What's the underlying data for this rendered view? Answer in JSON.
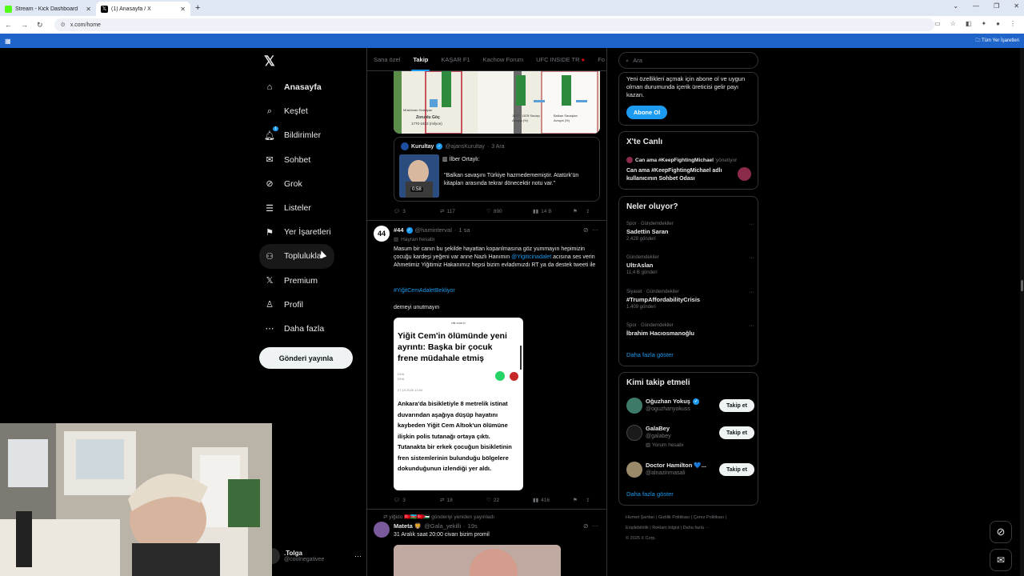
{
  "browser": {
    "tabs": [
      {
        "title": "Stream - Kick Dashboard",
        "fav_color": "#53fc18"
      },
      {
        "title": "(1) Anasayfa / X",
        "fav_color": "#000000"
      }
    ],
    "url": "x.com/home",
    "all_bookmarks": "Tüm Yer İşaretleri"
  },
  "sidebar": {
    "items": [
      {
        "label": "Anasayfa",
        "icon": "home-icon"
      },
      {
        "label": "Keşfet",
        "icon": "search-icon"
      },
      {
        "label": "Bildirimler",
        "icon": "bell-icon",
        "badge": "1"
      },
      {
        "label": "Sohbet",
        "icon": "mail-icon"
      },
      {
        "label": "Grok",
        "icon": "grok-icon"
      },
      {
        "label": "Listeler",
        "icon": "list-icon"
      },
      {
        "label": "Yer İşaretleri",
        "icon": "bookmark-icon"
      },
      {
        "label": "Topluluklar",
        "icon": "communities-icon"
      },
      {
        "label": "Premium",
        "icon": "x-icon"
      },
      {
        "label": "Profil",
        "icon": "profile-icon"
      },
      {
        "label": "Daha fazla",
        "icon": "more-icon"
      }
    ],
    "post_button": "Gönderi yayınla",
    "account": {
      "name": ".Tolga",
      "handle": "@coolnegativee"
    }
  },
  "feed": {
    "tabs": [
      "Sana özel",
      "Takip",
      "KAŞAR F1",
      "Kachow Forum",
      "UFC INSIDE TR",
      "Fo"
    ],
    "active_tab": "Takip",
    "chart_labels": [
      "Müslüman Hıristiyan",
      "Zorunlu Göç",
      "1770-1923 (milyon)",
      "1877 - 1878 Savaşı Avrupa (%)",
      "Balkan Savaşları Avrupa (%)"
    ],
    "quote": {
      "name": "Kurultay",
      "handle": "@ajansKurultay",
      "time": "3 Ara",
      "speaker": "İlber Ortaylı:",
      "video_time": "0:58",
      "text": "\"Balkan savaşını Türkiye hazmedememiştir. Atatürk'ün kitapları arasında tekrar dönecektir notu var.\""
    },
    "post1_actions": {
      "replies": "3",
      "reposts": "117",
      "likes": "890",
      "views": "14 B"
    },
    "post2": {
      "name": "#44",
      "handle": "@haminterval",
      "time": "1 sa",
      "subtitle": "Hayran hesabı",
      "text_a": "Masum bir canın bu şekilde hayattan koparılmasına göz yummayın hepimizin çocuğu kardeşi yeğeni var anne Nazlı Hanımın ",
      "mention": "@Yigiticinadalet",
      "text_b": " acısına ses verin Ahmetimiz Yiğitimiz Hakanımız hepsi bizim evladımızdı RT ya da destek tweeti ile",
      "hashtag": "#YiğitCemAdaletBekliyor",
      "text_c": "demeyi unutmayın",
      "card": {
        "source": "nfk.com.tr",
        "headline": "Yiğit Cem'in ölümünde yeni ayrıntı: Başka bir çocuk frene müdahale etmiş",
        "agency": "DHA",
        "agency2": "DHA",
        "date": "27.10.2025 13:04",
        "body": "Ankara'da bisikletiyle 8 metrelik istinat duvarından aşağıya düşüp hayatını kaybeden Yiğit Cem Altıok'un ölümüne ilişkin polis tutanağı ortaya çıktı. Tutanakta bir erkek çocuğun bisikletinin fren sistemlerinin bulunduğu bölgelere dokunduğunun izlendiği yer aldı."
      },
      "actions": {
        "replies": "3",
        "reposts": "18",
        "likes": "22",
        "views": "416"
      }
    },
    "post3": {
      "repost_by": "yiğido 🇹🇷🇦🇿🇹🇷🇵🇸 gönderiyi yeniden yayınladı",
      "name": "Mateta 🦁",
      "handle": "@Gala_yekilli",
      "time": "19s",
      "text": "31 Aralık saat 20:00 civarı bizim promil"
    }
  },
  "right": {
    "search_placeholder": "Ara",
    "premium_text": "Yeni özellikleri açmak için abone ol ve uygun olman durumunda içerik üreticisi gelir payı kazan.",
    "subscribe": "Abone Ol",
    "live": {
      "title": "X'te Canlı",
      "host": "Can ama #KeepFightingMichael",
      "host_suffix": "yönetiyor",
      "room": "Can ama #KeepFightingMichael adlı kullanıcının Sohbet Odası"
    },
    "trends_title": "Neler oluyor?",
    "trends": [
      {
        "cat": "Spor · Gündemdekiler",
        "name": "Sadettin Saran",
        "count": "2.428 gönderi"
      },
      {
        "cat": "Gündemdekiler",
        "name": "UltrAslan",
        "count": "11,4 B gönderi"
      },
      {
        "cat": "Siyaset · Gündemdekiler",
        "name": "#TrumpAffordabilityCrisis",
        "count": "1.409 gönderi"
      },
      {
        "cat": "Spor · Gündemdekiler",
        "name": "İbrahim Hacıosmanoğlu",
        "count": ""
      }
    ],
    "show_more": "Daha fazla göster",
    "wtf_title": "Kimi takip etmeli",
    "who_to_follow": [
      {
        "name": "Oğuzhan Yokuş",
        "handle": "@oguzhanyokuss",
        "extra": ""
      },
      {
        "name": "GalaBey",
        "handle": "@galabey",
        "extra": "Yorum hesabı"
      },
      {
        "name": "Doctor Hamilton 💙...",
        "handle": "@alnazinmasali",
        "extra": ""
      }
    ],
    "follow_label": "Takip et",
    "footer": [
      "Hizmet Şartları",
      "Gizlilik Politikası",
      "Çerez Politikası",
      "Erişilebilirlik",
      "Reklam bilgisi",
      "Daha fazla ···",
      "© 2025 X Corp."
    ]
  }
}
